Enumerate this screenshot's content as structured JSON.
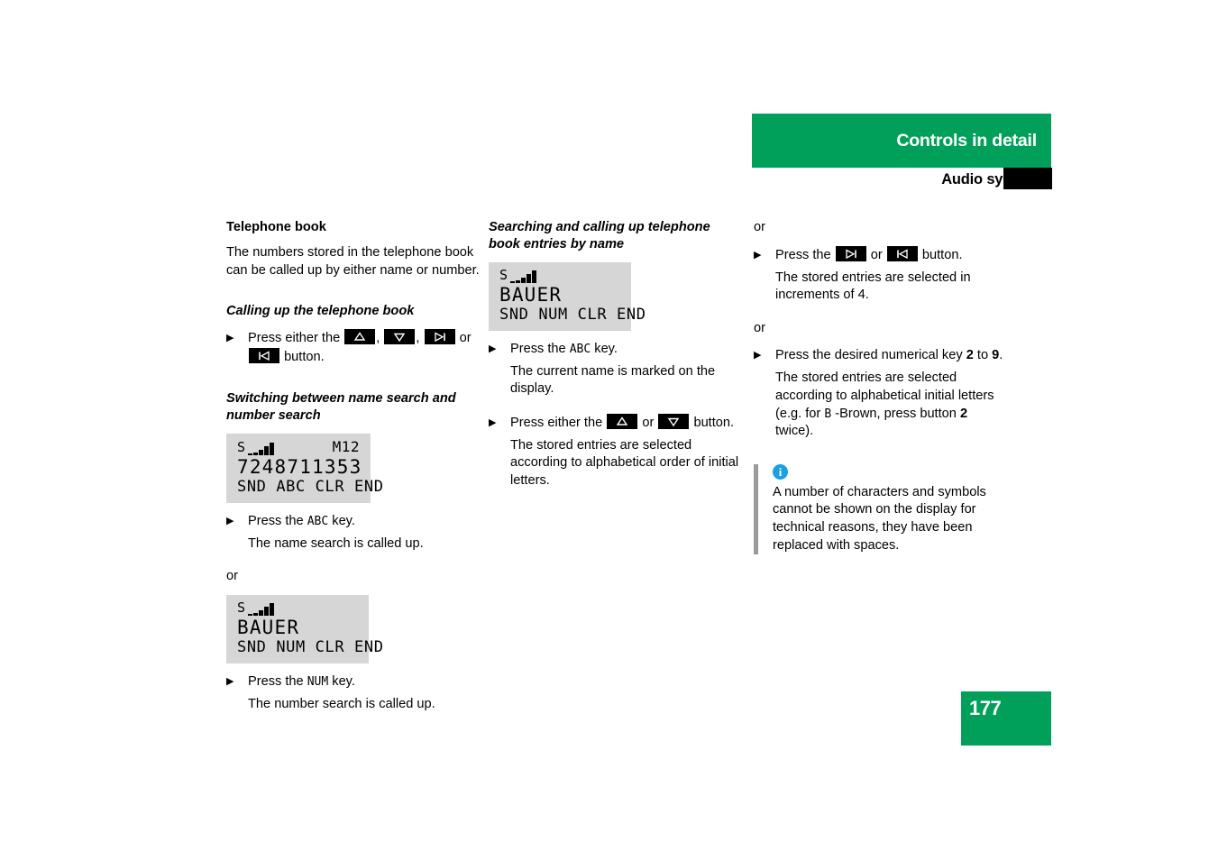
{
  "header": {
    "title": "Controls in detail",
    "subtitle": "Audio system",
    "green": "#00A05A"
  },
  "page_number": "177",
  "column_1": {
    "section_title": "Telephone book",
    "intro": "The numbers stored in the telephone book can be called up by either name or number.",
    "sub1_title": "Calling up the telephone book",
    "sub1_step_pre": "Press either the",
    "sub1_step_comma1": ",",
    "sub1_step_comma2": ",",
    "sub1_step_or": "or",
    "sub1_step_post": "button.",
    "sub2_title": "Switching between name search and number search",
    "display_number": {
      "indicator": "S",
      "memory": "M12",
      "main": "7248711353",
      "softkeys": "SND ABC CLR END"
    },
    "step_abc_pre": "Press the",
    "step_abc_key": "ABC",
    "step_abc_post": "key.",
    "result_abc": "The name search is called up.",
    "or": "or",
    "display_name": {
      "indicator": "S",
      "main": "BAUER",
      "softkeys": "SND NUM CLR END"
    },
    "step_num_pre": "Press the",
    "step_num_key": "NUM",
    "step_num_post": "key.",
    "result_num": "The number search is called up."
  },
  "column_2": {
    "section_title": "Searching and calling up telephone book entries by name",
    "display_name": {
      "indicator": "S",
      "main": "BAUER",
      "softkeys": "SND NUM CLR END"
    },
    "step_abc_pre": "Press the",
    "step_abc_key": "ABC",
    "step_abc_post": "key.",
    "result_abc": "The current name is marked on the display.",
    "step_updown_pre": "Press either the",
    "step_updown_or": "or",
    "step_updown_post": "button.",
    "result_updown": "The stored entries are selected according to alphabetical order of initial letters."
  },
  "column_3": {
    "or_1": "or",
    "step_skip_pre": "Press the",
    "step_skip_or": "or",
    "step_skip_post": "button.",
    "result_skip": "The stored entries are selected in increments of 4.",
    "or_2": "or",
    "step_num_pre": "Press the desired numerical key",
    "step_num_key_from": "2",
    "step_num_to": "to",
    "step_num_key_to": "9",
    "step_num_period": ".",
    "result_num_part1": "The stored entries are selected according to alphabetical initial letters (e.g. for",
    "result_num_lcd_b": "B",
    "result_num_part2": "-Brown, press button",
    "result_num_bold2": "2",
    "result_num_part3": "twice).",
    "note": {
      "icon": "info-icon",
      "text": "A number of characters and symbols cannot be shown on the display for technical reasons, they have been replaced with spaces."
    }
  }
}
